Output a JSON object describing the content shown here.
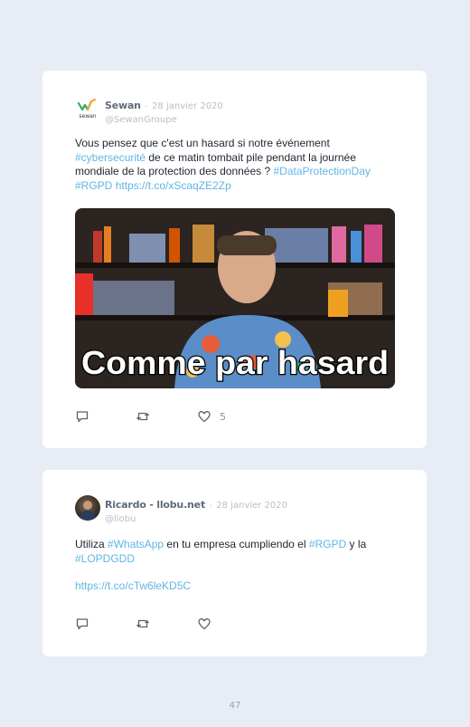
{
  "tweets": [
    {
      "author": "Sewan",
      "separator": "·",
      "date": "28 janvier 2020",
      "handle": "@SewanGroupe",
      "avatar_label": "sewan",
      "text": {
        "p1": "Vous pensez que c'est un hasard si notre événement ",
        "tag1": "#cybersecurité",
        "p2": " de ce matin tombait pile pendant la journée mondiale de la protection des données ? ",
        "tag2": "#DataProtectionDay",
        "p3": " ",
        "tag3": "#RGPD",
        "p4": " ",
        "link": "https://t.co/xScaqZE2Zp"
      },
      "media_caption": "Comme par hasard",
      "likes": "5"
    },
    {
      "author": "Ricardo - llobu.net",
      "separator": "·",
      "date": "28 janvier 2020",
      "handle": "@llobu",
      "text": {
        "p1": "Utiliza ",
        "tag1": "#WhatsApp",
        "p2": " en tu empresa cumpliendo el ",
        "tag2": "#RGPD",
        "p3": " y la ",
        "tag3": "#LOPDGDD",
        "link": "https://t.co/cTw6leKD5C"
      },
      "likes": ""
    }
  ],
  "page_number": "47",
  "colors": {
    "link": "#5fb6e4",
    "background": "#e8ecf5",
    "card": "#ffffff"
  },
  "icons": [
    "reply-icon",
    "retweet-icon",
    "like-icon"
  ]
}
